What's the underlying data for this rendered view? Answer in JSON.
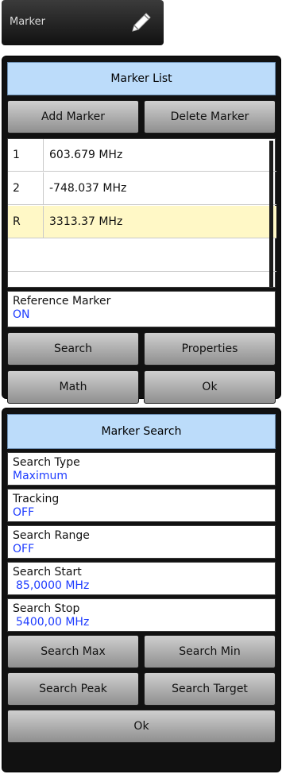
{
  "marker_button": {
    "label": "Marker",
    "icon": "pencil-icon"
  },
  "marker_list_panel": {
    "title": "Marker List",
    "add_label": "Add Marker",
    "delete_label": "Delete Marker",
    "rows": [
      {
        "id": "1",
        "value": "603.679 MHz"
      },
      {
        "id": "2",
        "value": "-748.037 MHz"
      },
      {
        "id": "R",
        "value": "3313.37 MHz"
      },
      {
        "id": "",
        "value": ""
      }
    ],
    "reference_label": "Reference Marker",
    "reference_value": "ON",
    "search_label": "Search",
    "properties_label": "Properties",
    "math_label": "Math",
    "ok_label": "Ok"
  },
  "marker_search_panel": {
    "title": "Marker Search",
    "fields": [
      {
        "label": "Search Type",
        "value": "Maximum"
      },
      {
        "label": "Tracking",
        "value": "OFF"
      },
      {
        "label": "Search Range",
        "value": "OFF"
      },
      {
        "label": "Search Start",
        "value": "85,0000 MHz"
      },
      {
        "label": "Search Stop",
        "value": "5400,00 MHz"
      }
    ],
    "search_max_label": "Search Max",
    "search_min_label": "Search Min",
    "search_peak_label": "Search Peak",
    "search_target_label": "Search Target",
    "ok_label": "Ok"
  },
  "colors": {
    "header_bg": "#bcdcfa",
    "value_text": "#1e3cff",
    "selected_row": "#fff8c6"
  }
}
